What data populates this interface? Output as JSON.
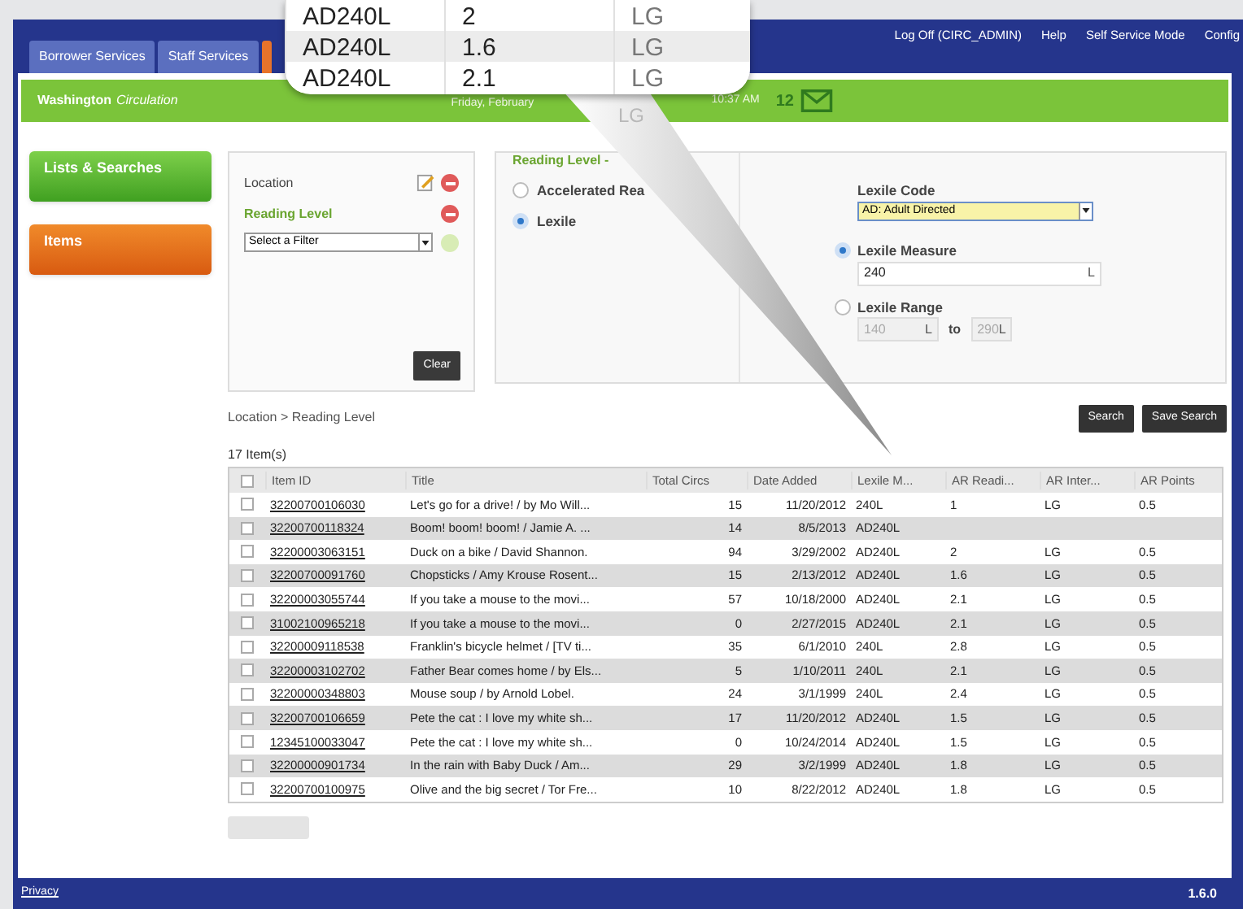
{
  "header": {
    "tabs": [
      {
        "label": "Borrower Services",
        "selected": false
      },
      {
        "label": "Staff Services",
        "selected": false
      },
      {
        "selected": true
      }
    ],
    "links": [
      "Log Off (CIRC_ADMIN)",
      "Help",
      "Self Service Mode",
      "Config"
    ]
  },
  "banner": {
    "library": "Washington",
    "module": "Circulation",
    "date": "Friday, February",
    "time": "10:37 AM",
    "message_count": "12"
  },
  "sidebar": {
    "items": [
      {
        "label": "Lists & Searches",
        "kind": "green"
      },
      {
        "label": "Items",
        "kind": "orange"
      }
    ]
  },
  "filters": {
    "items": [
      {
        "label": "Location",
        "active": false,
        "editable": true
      },
      {
        "label": "Reading Level",
        "active": true,
        "editable": false
      }
    ],
    "select_placeholder": "Select a Filter",
    "clear": "Clear"
  },
  "reading_level": {
    "title": "Reading Level -",
    "options": [
      {
        "label": "Accelerated Rea",
        "selected": false
      },
      {
        "label": "Lexile",
        "selected": true
      }
    ],
    "lexile_code_label": "Lexile Code",
    "lexile_code": "AD: Adult Directed",
    "measure": {
      "label": "Lexile Measure",
      "selected": true,
      "value": "240",
      "unit": "L"
    },
    "range": {
      "label": "Lexile Range",
      "selected": false,
      "from": "140",
      "from_unit": "L",
      "to_word": "to",
      "to": "290",
      "to_unit": "L"
    }
  },
  "breadcrumb": "Location > Reading Level",
  "buttons": [
    "Search",
    "Save Search"
  ],
  "table": {
    "count": "17 Item(s)",
    "select_all_checked": false,
    "columns": [
      "Item ID",
      "Title",
      "Total Circs",
      "Date Added",
      "Lexile M...",
      "AR Readi...",
      "AR Inter...",
      "AR Points"
    ],
    "rows": [
      {
        "checked": false,
        "cells": [
          "32200700106030",
          "Let's go for a drive! / by Mo Will...",
          "15",
          "11/20/2012",
          "240L",
          "1",
          "LG",
          "0.5"
        ]
      },
      {
        "checked": false,
        "cells": [
          "32200700118324",
          "Boom! boom! boom! / Jamie A. ...",
          "14",
          "8/5/2013",
          "AD240L",
          "",
          "",
          ""
        ]
      },
      {
        "checked": false,
        "cells": [
          "32200003063151",
          "Duck on a bike / David Shannon.",
          "94",
          "3/29/2002",
          "AD240L",
          "2",
          "LG",
          "0.5"
        ]
      },
      {
        "checked": false,
        "cells": [
          "32200700091760",
          "Chopsticks / Amy Krouse Rosent...",
          "15",
          "2/13/2012",
          "AD240L",
          "1.6",
          "LG",
          "0.5"
        ]
      },
      {
        "checked": false,
        "cells": [
          "32200003055744",
          "If you take a mouse to the movi...",
          "57",
          "10/18/2000",
          "AD240L",
          "2.1",
          "LG",
          "0.5"
        ]
      },
      {
        "checked": false,
        "cells": [
          "31002100965218",
          "If you take a mouse to the movi...",
          "0",
          "2/27/2015",
          "AD240L",
          "2.1",
          "LG",
          "0.5"
        ]
      },
      {
        "checked": false,
        "cells": [
          "32200009118538",
          "Franklin's bicycle helmet / [TV ti...",
          "35",
          "6/1/2010",
          "240L",
          "2.8",
          "LG",
          "0.5"
        ]
      },
      {
        "checked": false,
        "cells": [
          "32200003102702",
          "Father Bear comes home / by Els...",
          "5",
          "1/10/2011",
          "240L",
          "2.1",
          "LG",
          "0.5"
        ]
      },
      {
        "checked": false,
        "cells": [
          "32200000348803",
          "Mouse soup / by Arnold Lobel.",
          "24",
          "3/1/1999",
          "240L",
          "2.4",
          "LG",
          "0.5"
        ]
      },
      {
        "checked": false,
        "cells": [
          "32200700106659",
          "Pete the cat : I love my white sh...",
          "17",
          "11/20/2012",
          "AD240L",
          "1.5",
          "LG",
          "0.5"
        ]
      },
      {
        "checked": false,
        "cells": [
          "12345100033047",
          "Pete the cat : I love my white sh...",
          "0",
          "10/24/2014",
          "AD240L",
          "1.5",
          "LG",
          "0.5"
        ]
      },
      {
        "checked": false,
        "cells": [
          "32200000901734",
          "In the rain with Baby Duck / Am...",
          "29",
          "3/2/1999",
          "AD240L",
          "1.8",
          "LG",
          "0.5"
        ]
      },
      {
        "checked": false,
        "cells": [
          "32200700100975",
          "Olive and the big secret / Tor Fre...",
          "10",
          "8/22/2012",
          "AD240L",
          "1.8",
          "LG",
          "0.5"
        ]
      }
    ]
  },
  "footer": {
    "link": "Privacy",
    "version": "1.6.0"
  },
  "callout": {
    "rows": [
      [
        "AD240L",
        "2",
        "LG"
      ],
      [
        "AD240L",
        "1.6",
        "LG"
      ],
      [
        "AD240L",
        "2.1",
        "LG"
      ]
    ],
    "faded": "LG"
  }
}
